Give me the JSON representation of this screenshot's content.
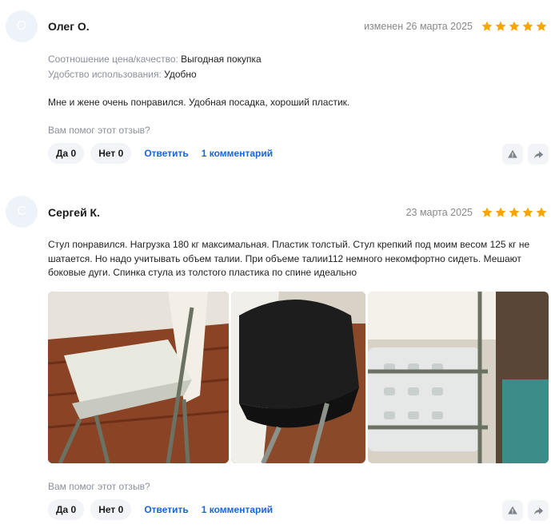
{
  "reviews": [
    {
      "avatar_letter": "О",
      "author": "Олег О.",
      "date": "изменен 26 марта 2025",
      "rating": 5,
      "price_label": "Соотношение цена/качество:",
      "price_value": "Выгодная покупка",
      "usability_label": "Удобство использования:",
      "usability_value": "Удобно",
      "text": "Мне и жене очень понравился. Удобная посадка, хороший пластик.",
      "helpful_question": "Вам помог этот отзыв?",
      "yes": "Да 0",
      "no": "Нет 0",
      "reply": "Ответить",
      "comments": "1 комментарий"
    },
    {
      "avatar_letter": "С",
      "author": "Сергей К.",
      "date": "23 марта 2025",
      "rating": 5,
      "text": "Стул понравился. Нагрузка 180 кг максимальная. Пластик толстый. Стул крепкий под моим весом 125 кг не шатается. Но надо учитывать объем талии. При объеме талии112 немного некомфортно сидеть. Мешают боковые дуги. Спинка стула из толстого пластика по спине идеально",
      "helpful_question": "Вам помог этот отзыв?",
      "yes": "Да 0",
      "no": "Нет 0",
      "reply": "Ответить",
      "comments": "1 комментарий"
    }
  ],
  "colors": {
    "star": "#f7a600",
    "link": "#1a64d8",
    "muted": "#8a8f99",
    "pill_bg": "#f3f4f7",
    "avatar_bg": "#eef2f9"
  },
  "icons": [
    "star-icon",
    "report-icon",
    "share-icon"
  ]
}
